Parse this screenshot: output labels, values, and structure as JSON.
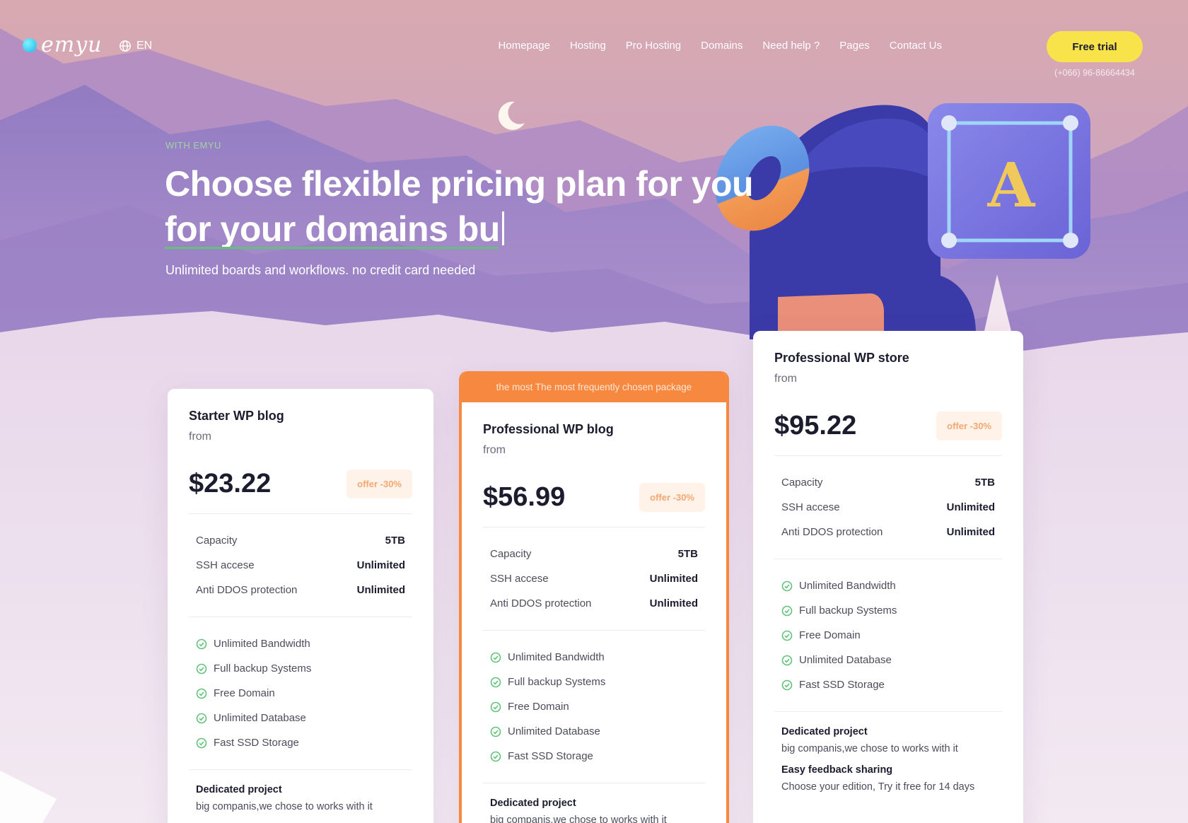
{
  "brand": {
    "logo": "emyu"
  },
  "header": {
    "language": "EN",
    "nav": [
      "Homepage",
      "Hosting",
      "Pro Hosting",
      "Domains",
      "Need help ?",
      "Pages",
      "Contact Us"
    ],
    "cta": "Free trial",
    "phone": "(+066) 96-86664434"
  },
  "hero": {
    "eyebrow": "WITH EMYU",
    "title_line1": "Choose flexible pricing plan for you",
    "title_line2": "for your domains bu",
    "subtitle": "Unlimited boards and workflows. no credit card needed"
  },
  "colors": {
    "accent_orange": "#f6883f",
    "cta_yellow": "#f9e34a",
    "check_green": "#62c27a"
  },
  "plans": [
    {
      "name": "Starter WP blog",
      "from": "from",
      "price": "$23.22",
      "offer": "offer -30%",
      "specs": [
        {
          "label": "Capacity",
          "value": "5TB"
        },
        {
          "label": "SSH accese",
          "value": "Unlimited"
        },
        {
          "label": "Anti DDOS protection",
          "value": "Unlimited"
        }
      ],
      "features": [
        "Unlimited Bandwidth",
        "Full backup Systems",
        "Free Domain",
        "Unlimited Database",
        "Fast SSD Storage"
      ],
      "dedicated_title": "Dedicated project",
      "dedicated_text": "big companis,we chose to works with it"
    },
    {
      "ribbon": "the most The most frequently chosen package",
      "name": "Professional WP blog",
      "from": "from",
      "price": "$56.99",
      "offer": "offer -30%",
      "specs": [
        {
          "label": "Capacity",
          "value": "5TB"
        },
        {
          "label": "SSH accese",
          "value": "Unlimited"
        },
        {
          "label": "Anti DDOS protection",
          "value": "Unlimited"
        }
      ],
      "features": [
        "Unlimited Bandwidth",
        "Full backup Systems",
        "Free Domain",
        "Unlimited Database",
        "Fast SSD Storage"
      ],
      "dedicated_title": "Dedicated project",
      "dedicated_text": "big companis,we chose to works with it"
    },
    {
      "name": "Professional WP store",
      "from": "from",
      "price": "$95.22",
      "offer": "offer -30%",
      "specs": [
        {
          "label": "Capacity",
          "value": "5TB"
        },
        {
          "label": "SSH accese",
          "value": "Unlimited"
        },
        {
          "label": "Anti DDOS protection",
          "value": "Unlimited"
        }
      ],
      "features": [
        "Unlimited Bandwidth",
        "Full backup Systems",
        "Free Domain",
        "Unlimited Database",
        "Fast SSD Storage"
      ],
      "dedicated_title": "Dedicated project",
      "dedicated_text": "big companis,we chose to works with it",
      "feedback_title": "Easy feedback sharing",
      "feedback_text": "Choose your edition, Try it free for 14 days"
    }
  ]
}
